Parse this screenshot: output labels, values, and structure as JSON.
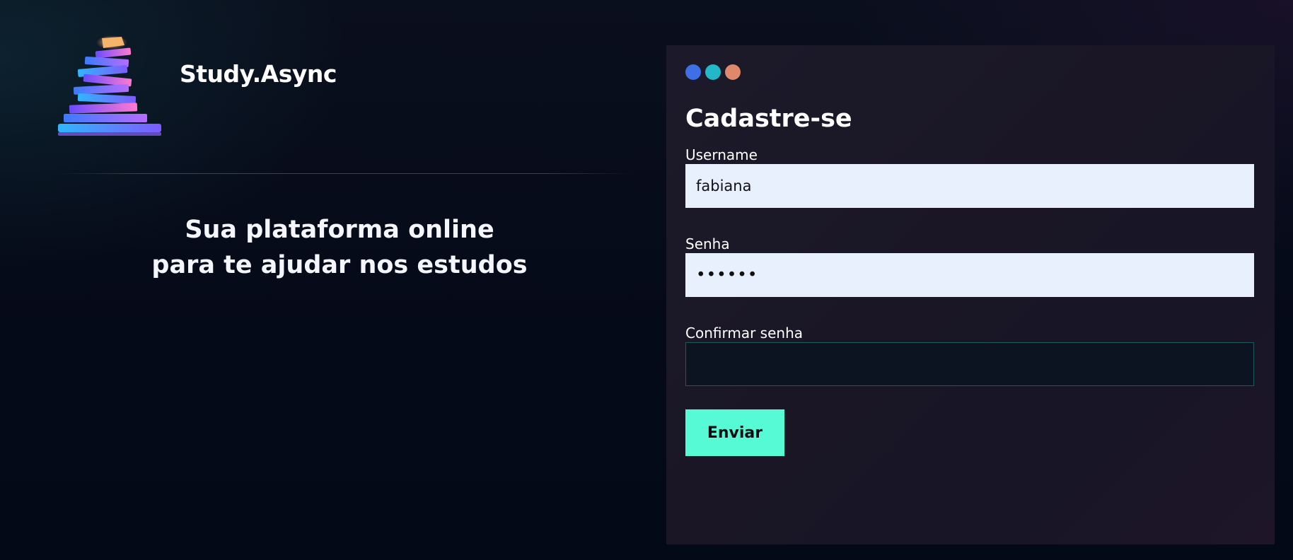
{
  "app": {
    "brand_name": "Study.Async",
    "tagline_lines": [
      "Sua plataforma online",
      "para te ajudar nos estudos"
    ],
    "logo_icon": "stacked-books-logo-icon"
  },
  "window_controls": {
    "dots": [
      {
        "name": "blue-dot",
        "color": "#3f6fe6"
      },
      {
        "name": "teal-dot",
        "color": "#22b7c9"
      },
      {
        "name": "orange-dot",
        "color": "#de8a6a"
      }
    ]
  },
  "form": {
    "title": "Cadastre-se",
    "fields": {
      "username": {
        "label": "Username",
        "value": "fabiana",
        "placeholder": ""
      },
      "password": {
        "label": "Senha",
        "value": "••••••",
        "placeholder": ""
      },
      "confirm_password": {
        "label": "Confirmar senha",
        "value": "",
        "placeholder": ""
      }
    },
    "submit_label": "Enviar"
  },
  "colors": {
    "accent": "#56fbd6",
    "input_filled_bg": "#e8f0fe",
    "input_empty_bg": "#0b1420",
    "input_empty_border": "#1e5a5a"
  }
}
